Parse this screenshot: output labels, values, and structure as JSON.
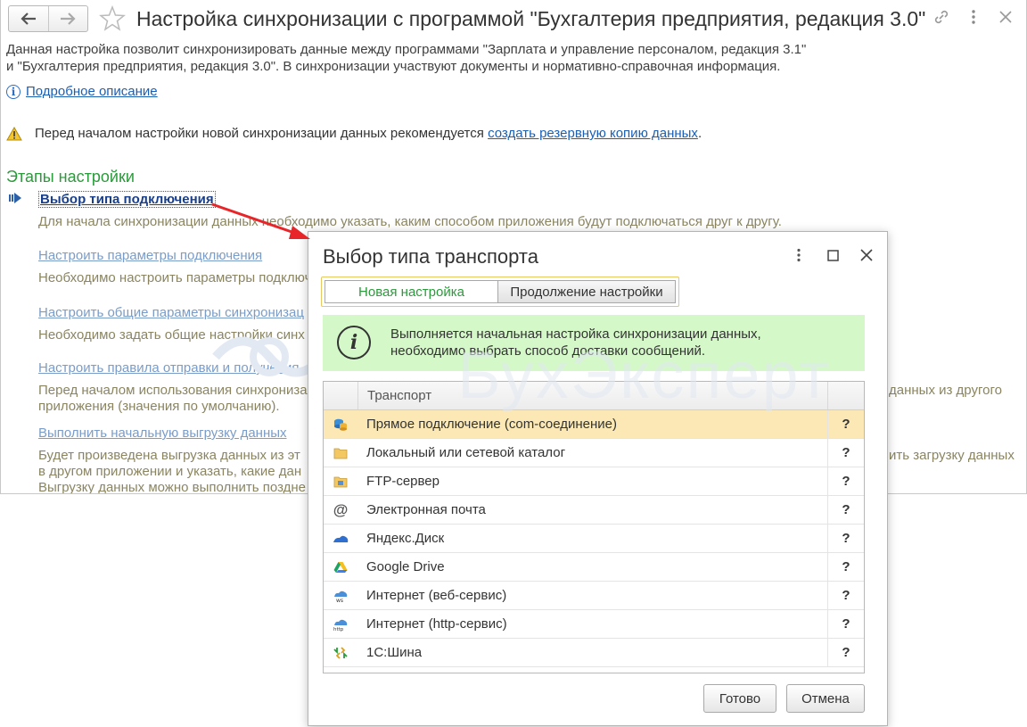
{
  "window": {
    "title": "Настройка синхронизации с программой \"Бухгалтерия предприятия, редакция 3.0\"",
    "description_line1": "Данная настройка позволит синхронизировать данные между программами \"Зарплата и управление персоналом, редакция 3.1\"",
    "description_line2": "и \"Бухгалтерия предприятия, редакция 3.0\". В синхронизации участвуют документы и нормативно-справочная информация.",
    "details_link": "Подробное описание",
    "warning_text": "Перед началом настройки новой синхронизации данных рекомендуется",
    "backup_link": "создать резервную копию данных",
    "warning_tail": "."
  },
  "stages": {
    "title": "Этапы настройки",
    "steps": [
      {
        "label": "Выбор типа подключения",
        "text1": "Для начала синхронизации данных необходимо указать, каким способом приложения будут подключаться друг к другу.",
        "text2": ""
      },
      {
        "label": "Настроить параметры подключения",
        "text1": "Необходимо настроить параметры подключ",
        "text2": ""
      },
      {
        "label": "Настроить общие параметры синхронизац",
        "text1": "Необходимо задать общие настройки синх",
        "text2": ""
      },
      {
        "label": "Настроить правила отправки и получения",
        "text1": "Перед началом использования синхрониза",
        "text2": "приложения (значения по умолчанию)."
      },
      {
        "label": "Выполнить начальную выгрузку данных",
        "text1": "Будет произведена выгрузка данных из эт",
        "text2": "в другом приложении и указать, какие дан",
        "text3": "Выгрузку данных можно выполнить поздне"
      }
    ],
    "right_fragments": {
      "f1": ".",
      "f2": "данных из другого",
      "f3": "ить загрузку данных"
    }
  },
  "watermark": "БухЭксперт",
  "dialog": {
    "title": "Выбор типа транспорта",
    "tabs": {
      "new": "Новая настройка",
      "cont": "Продолжение настройки"
    },
    "info_line1": "Выполняется начальная настройка синхронизации данных,",
    "info_line2": "необходимо выбрать способ доставки сообщений.",
    "column_header": "Транспорт",
    "rows": [
      {
        "name": "Прямое подключение (com-соединение)",
        "q": "?",
        "icon": "database-icon"
      },
      {
        "name": "Локальный или сетевой каталог",
        "q": "?",
        "icon": "folder-icon"
      },
      {
        "name": "FTP-сервер",
        "q": "?",
        "icon": "ftp-folder-icon"
      },
      {
        "name": "Электронная почта",
        "q": "?",
        "icon": "at-sign-icon"
      },
      {
        "name": "Яндекс.Диск",
        "q": "?",
        "icon": "cloud-icon"
      },
      {
        "name": "Google Drive",
        "q": "?",
        "icon": "google-drive-icon"
      },
      {
        "name": "Интернет (веб-сервис)",
        "q": "?",
        "icon": "web-service-icon"
      },
      {
        "name": "Интернет (http-сервис)",
        "q": "?",
        "icon": "http-service-icon"
      },
      {
        "name": "1С:Шина",
        "q": "?",
        "icon": "bus-icon"
      }
    ],
    "ok_label": "Готово",
    "cancel_label": "Отмена"
  },
  "colors": {
    "accent_green": "#2a9b3a",
    "link_blue": "#1a5fb4",
    "selected_row": "#fbe8b4",
    "info_banner": "#d4f8c8"
  }
}
